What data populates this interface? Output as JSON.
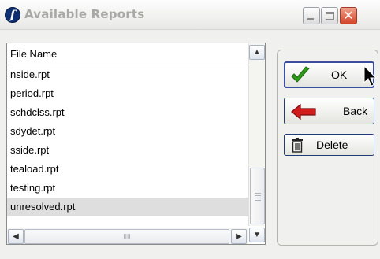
{
  "window": {
    "app_icon_glyph": "f",
    "title": "Available Reports",
    "controls": {
      "minimize_icon": "minimize-icon",
      "maximize_icon": "maximize-icon",
      "close_glyph": "✕"
    }
  },
  "file_list": {
    "header": "File Name",
    "rows": [
      {
        "name": "nside.rpt",
        "selected": false
      },
      {
        "name": "period.rpt",
        "selected": false
      },
      {
        "name": "schdclss.rpt",
        "selected": false
      },
      {
        "name": "sdydet.rpt",
        "selected": false
      },
      {
        "name": "sside.rpt",
        "selected": false
      },
      {
        "name": "teaload.rpt",
        "selected": false
      },
      {
        "name": "testing.rpt",
        "selected": false
      },
      {
        "name": "unresolved.rpt",
        "selected": true
      }
    ],
    "scrollbar": {
      "up_glyph": "▲",
      "down_glyph": "▼",
      "left_glyph": "◀",
      "right_glyph": "▶",
      "hthumb_grip": "IIII"
    }
  },
  "actions": {
    "ok_label": "OK",
    "back_label": "Back",
    "delete_label": "Delete"
  },
  "colors": {
    "ok_check": "#2f9a1a",
    "back_arrow": "#d21c1c",
    "app_icon_bg": "#0f2f73",
    "button_border": "#1f3b78"
  }
}
